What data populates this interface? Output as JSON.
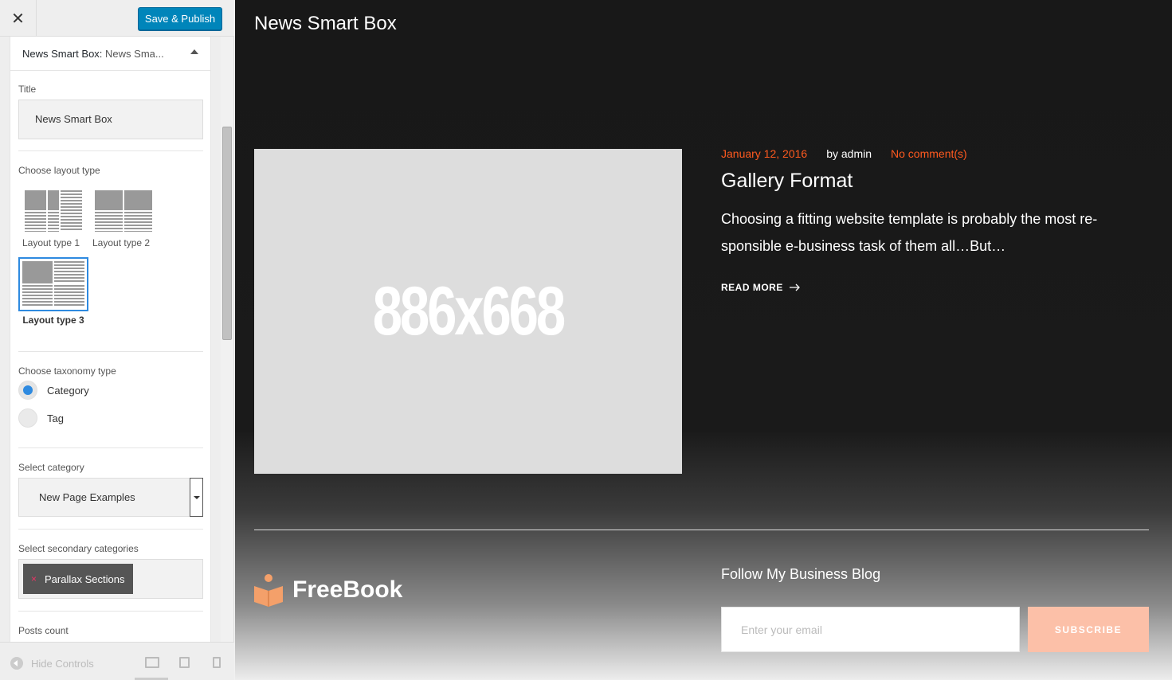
{
  "topbar": {
    "close_glyph": "✕",
    "save_label": "Save & Publish"
  },
  "widget": {
    "prefix": "News Smart Box:",
    "name": "News Sma..."
  },
  "form": {
    "title_label": "Title",
    "title_value": "News Smart Box",
    "layout_label": "Choose layout type",
    "layouts": [
      {
        "label": "Layout type 1",
        "selected": false
      },
      {
        "label": "Layout type 2",
        "selected": false
      },
      {
        "label": "Layout type 3",
        "selected": true
      }
    ],
    "taxonomy_label": "Choose taxonomy type",
    "taxonomy_options": [
      {
        "label": "Category",
        "selected": true
      },
      {
        "label": "Tag",
        "selected": false
      }
    ],
    "category_label": "Select category",
    "category_value": "New Page Examples",
    "secondary_label": "Select secondary categories",
    "secondary_tag": "Parallax Sections",
    "secondary_tag_remove": "×",
    "posts_count_label": "Posts count"
  },
  "footer_bar": {
    "hide_controls": "Hide Controls"
  },
  "preview": {
    "section_title": "News Smart Box",
    "placeholder_text": "886x668",
    "post": {
      "date": "January 12, 2016",
      "author": "by admin",
      "comments": "No comment(s)",
      "title": "Gallery Format",
      "excerpt": "Choosing a fitting website template is probably the most re-sponsible e-business task of them all…But…",
      "read_more": "READ MORE"
    },
    "logo_text": "FreeBook",
    "follow_title": "Follow My Business Blog",
    "email_placeholder": "Enter your email",
    "subscribe_label": "SUBSCRIBE"
  },
  "colors": {
    "accent": "#0085ba",
    "orange": "#ff5a1f",
    "selected": "#2e8ae0",
    "logo": "#f4a06a"
  }
}
